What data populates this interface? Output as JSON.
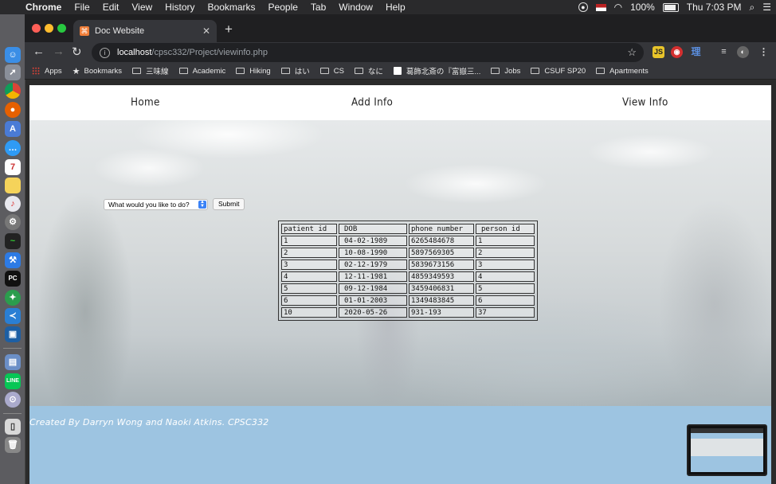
{
  "menubar": {
    "app": "Chrome",
    "menus": [
      "File",
      "Edit",
      "View",
      "History",
      "Bookmarks",
      "People",
      "Tab",
      "Window",
      "Help"
    ],
    "battery": "100%",
    "clock": "Thu 7:03 PM"
  },
  "browser": {
    "tab_title": "Doc Website",
    "url_host": "localhost",
    "url_path": "/cpsc332/Project/viewinfo.php",
    "bookmarks": [
      "Apps",
      "Bookmarks",
      "三味線",
      "Academic",
      "Hiking",
      "はい",
      "CS",
      "なに",
      "葛飾北斎の『富嶽三...",
      "Jobs",
      "CSUF SP20",
      "Apartments"
    ]
  },
  "nav": {
    "home": "Home",
    "add": "Add Info",
    "view": "View Info"
  },
  "form": {
    "select_value": "What would you like to do?",
    "submit": "Submit"
  },
  "table": {
    "headers": [
      "patient id",
      "DOB",
      "phone number",
      "person id"
    ],
    "rows": [
      [
        "1",
        "04-02-1989",
        "6265484678",
        "1"
      ],
      [
        "2",
        "10-08-1990",
        "5897569305",
        "2"
      ],
      [
        "3",
        "02-12-1979",
        "5839673156",
        "3"
      ],
      [
        "4",
        "12-11-1981",
        "4859349593",
        "4"
      ],
      [
        "5",
        "09-12-1984",
        "3459406831",
        "5"
      ],
      [
        "6",
        "01-01-2003",
        "1349483845",
        "6"
      ],
      [
        "10",
        "2020-05-26",
        "931-193",
        "37"
      ]
    ]
  },
  "footer": {
    "credit": "Created By Darryn Wong and Naoki Atkins. CPSC332"
  },
  "colors": {
    "footer_bg": "#9dc4e1",
    "chrome_dark": "#35363a"
  }
}
